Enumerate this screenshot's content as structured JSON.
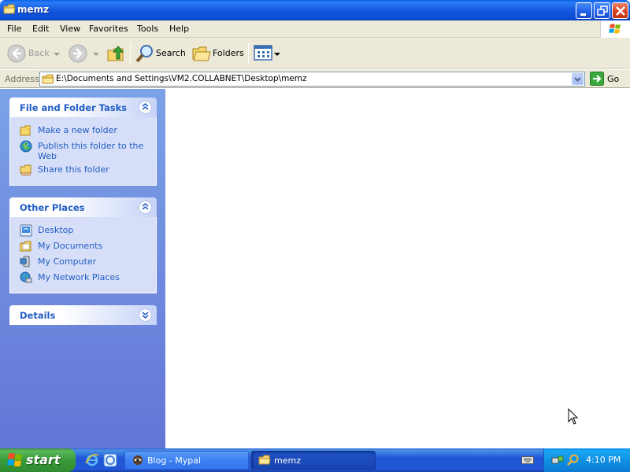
{
  "window": {
    "title": "memz",
    "icon": "folder-icon"
  },
  "menu": [
    "File",
    "Edit",
    "View",
    "Favorites",
    "Tools",
    "Help"
  ],
  "toolbar": {
    "back_label": "Back",
    "search_label": "Search",
    "folders_label": "Folders"
  },
  "address": {
    "label": "Address",
    "path": "E:\\Documents and Settings\\VM2.COLLABNET\\Desktop\\memz",
    "go_label": "Go"
  },
  "panels": {
    "tasks": {
      "title": "File and Folder Tasks",
      "items": [
        {
          "label": "Make a new folder",
          "icon": "new-folder-icon"
        },
        {
          "label": "Publish this folder to the Web",
          "line1": "Publish this folder to the",
          "line2": "Web",
          "icon": "publish-web-icon"
        },
        {
          "label": "Share this folder",
          "icon": "share-folder-icon"
        }
      ]
    },
    "places": {
      "title": "Other Places",
      "items": [
        {
          "label": "Desktop",
          "icon": "desktop-icon"
        },
        {
          "label": "My Documents",
          "icon": "my-documents-icon"
        },
        {
          "label": "My Computer",
          "icon": "my-computer-icon"
        },
        {
          "label": "My Network Places",
          "icon": "network-places-icon"
        }
      ]
    },
    "details": {
      "title": "Details"
    }
  },
  "taskbar": {
    "start_label": "start",
    "tasks": [
      {
        "label": "Blog - Mypal",
        "active": false
      },
      {
        "label": "memz",
        "active": true
      }
    ],
    "clock": "4:10 PM"
  },
  "colors": {
    "title_bar": "#0b4cd2",
    "task_pane": "#6375d6",
    "link_blue": "#215dc6",
    "start_green": "#379b37",
    "taskbar_blue": "#2157d7"
  }
}
